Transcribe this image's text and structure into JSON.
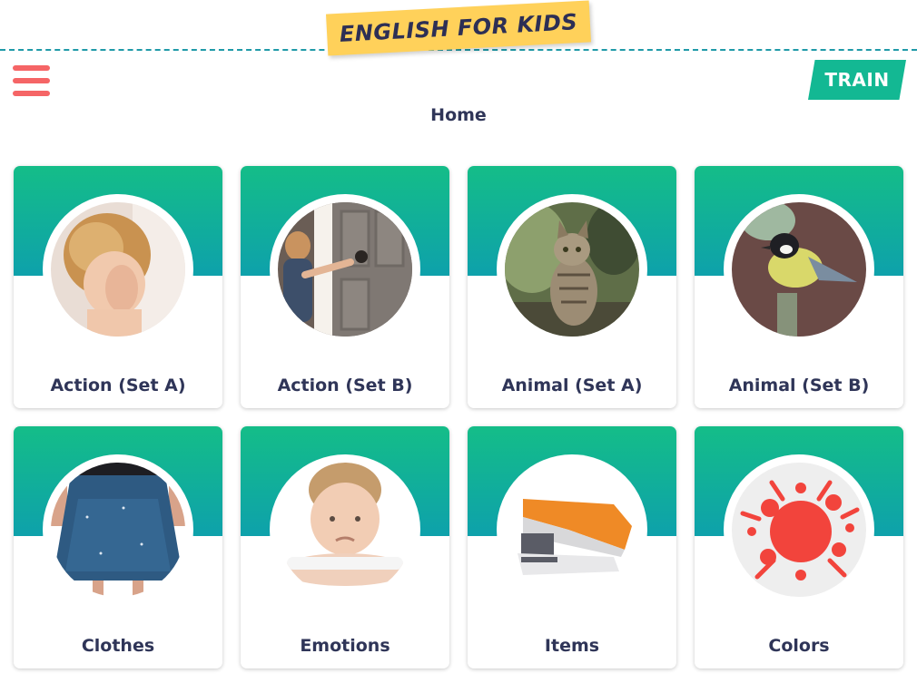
{
  "header": {
    "logo_text": "ENGLISH FOR KIDS",
    "menu_icon": "hamburger-icon",
    "train_label": "TRAIN",
    "accent": "#f56566",
    "train_color": "#13b893",
    "logo_color": "#ffd15a"
  },
  "page": {
    "title": "Home"
  },
  "categories": [
    {
      "label": "Action (Set A)",
      "image": "child-covering-eyes-photo"
    },
    {
      "label": "Action (Set B)",
      "image": "child-opening-door-photo"
    },
    {
      "label": "Animal (Set A)",
      "image": "cat-photo"
    },
    {
      "label": "Animal (Set B)",
      "image": "bird-photo"
    },
    {
      "label": "Clothes",
      "image": "skirt-photo"
    },
    {
      "label": "Emotions",
      "image": "sad-boy-photo"
    },
    {
      "label": "Items",
      "image": "stapler-photo"
    },
    {
      "label": "Colors",
      "image": "red-paint-splash-photo"
    }
  ],
  "card_gradient": [
    "#14bd88",
    "#0ea1ab"
  ]
}
